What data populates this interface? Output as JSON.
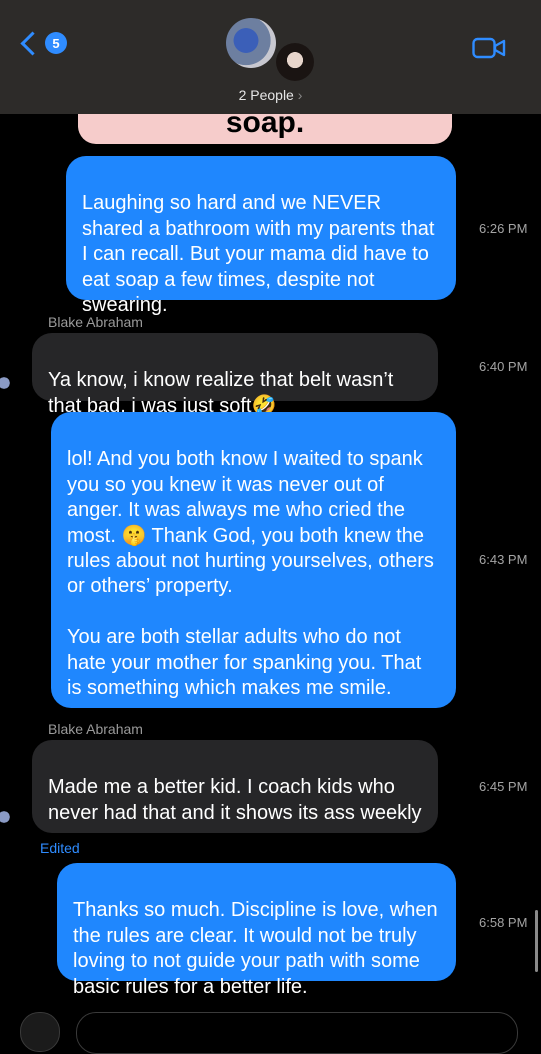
{
  "header": {
    "unread_count": "5",
    "group_label": "2 People",
    "group_arrow": "›",
    "icons": {
      "back": "chevron-left-icon",
      "video": "video-camera-icon"
    },
    "accent": "#2f8cff"
  },
  "prev_message_fragment": "soap.",
  "messages": [
    {
      "text": "Laughing so hard and we NEVER shared a bathroom with my parents that I can recall.  But your mama did have to eat soap a few times, despite not swearing.",
      "time": "6:26 PM"
    },
    {
      "sender": "Blake Abraham",
      "text": "Ya know, i know realize that belt wasn’t that bad, i was just soft🤣",
      "time": "6:40 PM"
    },
    {
      "text": "lol!  And you both know I waited to spank you so you knew it was never out of anger.   It was always me who cried the most.  🤫  Thank God, you both knew the rules about not hurting yourselves, others or others’ property.\n\nYou are both stellar adults who do not hate your mother for spanking you.  That is something which makes me smile.",
      "time": "6:43 PM"
    },
    {
      "sender": "Blake Abraham",
      "text": "Made me a better kid. I coach kids who never had that and it shows its ass weekly",
      "time": "6:45 PM",
      "status": "Edited"
    },
    {
      "text": "Thanks so much.   Discipline is love, when the rules are clear.   It would not be truly loving to not guide your path with some basic rules for a better life.",
      "time": "6:58 PM"
    }
  ],
  "colors": {
    "outgoing": "#1f87fe",
    "incoming": "#262628",
    "background": "#000000"
  }
}
